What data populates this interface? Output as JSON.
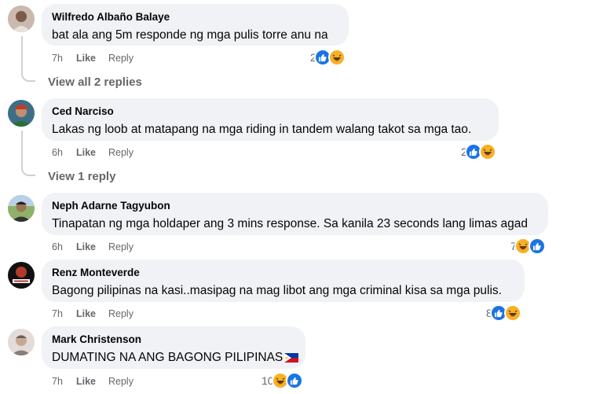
{
  "comments": [
    {
      "name": "Wilfredo Albaño Balaye",
      "text": "bat ala ang 5m responde ng mga pulis torre anu na",
      "time": "7h",
      "like": "Like",
      "reply": "Reply",
      "reaction_count": "2",
      "reactions": [
        "like-icon",
        "haha-icon"
      ],
      "view_replies": "View all 2 replies",
      "avatar_colors": [
        "#c9b9b0",
        "#7a5a4a"
      ]
    },
    {
      "name": "Ced Narciso",
      "text": "Lakas ng loob at matapang na mga riding in tandem walang takot sa mga tao.",
      "time": "6h",
      "like": "Like",
      "reply": "Reply",
      "reaction_count": "2",
      "reactions": [
        "like-icon",
        "haha-icon"
      ],
      "view_replies": "View 1 reply",
      "avatar_colors": [
        "#2a6e3a",
        "#c23b2a"
      ]
    },
    {
      "name": "Neph Adarne Tagyubon",
      "text": "Tinapatan ng mga holdaper ang 3 mins response. Sa kanila 23 seconds lang limas agad",
      "time": "6h",
      "like": "Like",
      "reply": "Reply",
      "reaction_count": "7",
      "reactions": [
        "haha-icon",
        "like-icon"
      ],
      "avatar_colors": [
        "#6f8f5a",
        "#333333"
      ]
    },
    {
      "name": "Renz Monteverde",
      "text": "Bagong pilipinas na kasi..masipag na mag libot ang mga criminal kisa sa mga pulis.",
      "time": "7h",
      "like": "Like",
      "reply": "Reply",
      "reaction_count": "8",
      "reactions": [
        "like-icon",
        "haha-icon"
      ],
      "avatar_colors": [
        "#111111",
        "#b33a2a"
      ]
    },
    {
      "name": "Mark Christenson",
      "text": "DUMATING NA ANG BAGONG PILIPINAS",
      "time": "7h",
      "like": "Like",
      "reply": "Reply",
      "reaction_count": "10",
      "reactions": [
        "haha-icon",
        "like-icon"
      ],
      "avatar_colors": [
        "#d8d0cc",
        "#8a7c78"
      ]
    }
  ],
  "colors": {
    "bubble_bg": "#f0f2f5",
    "meta_text": "#65676b",
    "like_blue": "#1b74e4",
    "haha_yellow": "#f7b125"
  }
}
